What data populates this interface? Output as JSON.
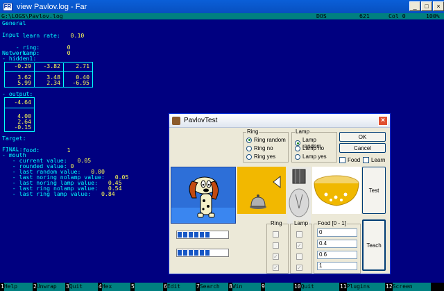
{
  "window": {
    "title": "view Pavlov.log - Far",
    "minimize": "_",
    "maximize": "□",
    "close": "×"
  },
  "status": {
    "path": "G:\\LOGS\\Pavlov.log",
    "encoding": "DOS",
    "size": "621",
    "col_label": "Col 0",
    "percent": "100%"
  },
  "log": {
    "general": "General",
    "learn_label": "- learn rate:",
    "learn_value": "0.10",
    "input": "Input",
    "ring_label": "- ring:",
    "ring_value": "0",
    "lamp_label": "- lamp:",
    "lamp_value": "0",
    "network": "Network",
    "hidden": "- hidden1:",
    "hidden_matrix": [
      [
        "-0.29",
        "-3.82",
        "2.71"
      ],
      [
        "3.62",
        "3.48",
        "0.40"
      ],
      [
        "5.99",
        "2.34",
        "-6.95"
      ]
    ],
    "output": "- output:",
    "output_matrix": [
      "-4.64",
      "4.00",
      "2.64",
      "-0.15"
    ],
    "target": "Target:",
    "food_label": "- food:",
    "food_value": "1",
    "final": "FINAL:",
    "mouth": "- mouth",
    "current_label": "- current value:",
    "current_value": "0.05",
    "rounded_label": "- rounded value:",
    "rounded_value": "0",
    "last_random_label": "- last random value:",
    "last_random_value": "0.00",
    "noring_nolamp_label": "- last noring nolamp value:",
    "noring_nolamp_value": "0.05",
    "noring_lamp_label": "- last noring lamp value:",
    "noring_lamp_value": "0.45",
    "ring_nolamp_label": "- last ring nolamp value:",
    "ring_nolamp_value": "0.54",
    "ring_lamp_label": "- last ring lamp value:",
    "ring_lamp_value": "0.84"
  },
  "keys": [
    {
      "n": "1",
      "l": "Help"
    },
    {
      "n": "2",
      "l": "Unwrap"
    },
    {
      "n": "3",
      "l": "Quit"
    },
    {
      "n": "4",
      "l": "Hex"
    },
    {
      "n": "5",
      "l": ""
    },
    {
      "n": "6",
      "l": "Edit"
    },
    {
      "n": "7",
      "l": "Search"
    },
    {
      "n": "8",
      "l": "Win"
    },
    {
      "n": "9",
      "l": ""
    },
    {
      "n": "10",
      "l": "Quit"
    },
    {
      "n": "11",
      "l": "Plugins"
    },
    {
      "n": "12",
      "l": "Screen"
    }
  ],
  "dialog": {
    "title": "PavlovTest",
    "close": "×",
    "ring_group": "Ring",
    "ring_options": [
      "Ring random",
      "Ring no",
      "Ring yes"
    ],
    "lamp_group": "Lamp",
    "lamp_options": [
      "Lamp random",
      "Lamp no",
      "Lamp yes"
    ],
    "ok": "OK",
    "cancel": "Cancel",
    "food_check": "Food",
    "learn_check": "Learn",
    "test": "Test",
    "teach": "Teach",
    "ring_col": "Ring",
    "lamp_col": "Lamp",
    "food_col": "Food [0 - 1]",
    "food_values": [
      "0",
      "0.4",
      "0.6",
      "1"
    ],
    "progress": [
      0.72,
      0.72
    ],
    "colors": {
      "accent": "#0831d9",
      "progress": "#1757c5"
    }
  }
}
